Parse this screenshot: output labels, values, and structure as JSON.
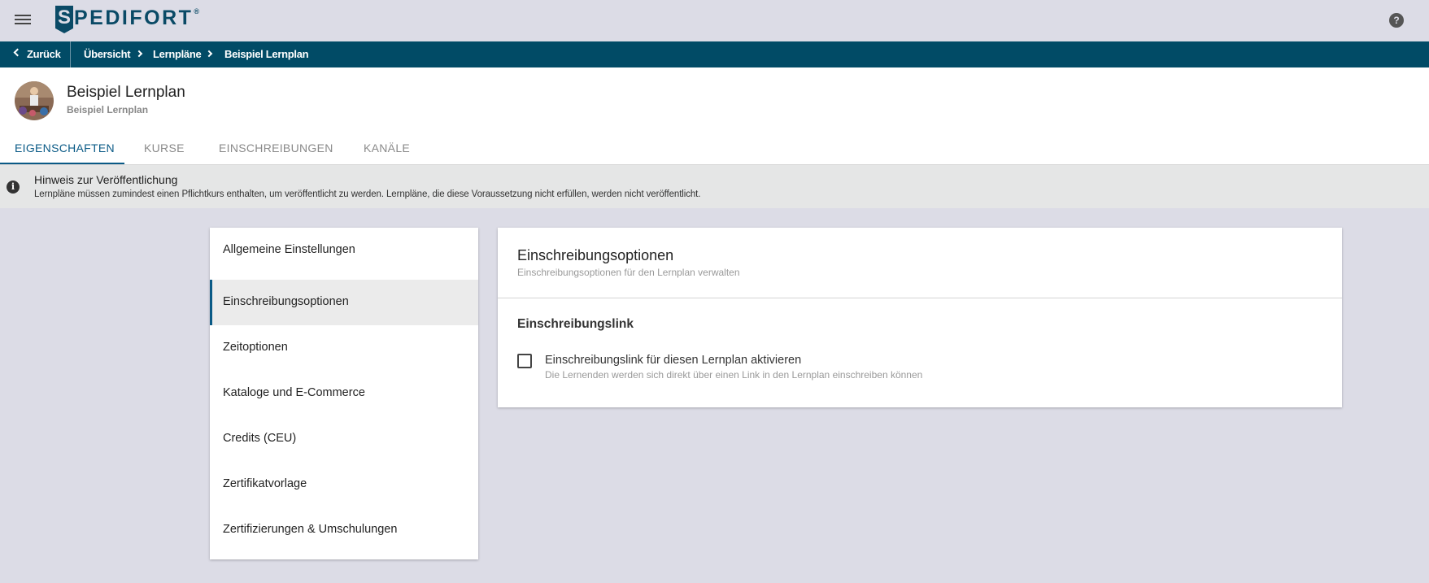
{
  "topbar": {
    "menu_icon": "hamburger-icon",
    "logo": {
      "letter": "S",
      "text": "PEDIFORT",
      "registered": "®"
    },
    "help_icon": "help-icon",
    "help_glyph": "?"
  },
  "navbar": {
    "back_label": "Zurück",
    "breadcrumbs": [
      "Übersicht",
      "Lernpläne",
      "Beispiel Lernplan"
    ]
  },
  "header": {
    "title": "Beispiel Lernplan",
    "subtitle": "Beispiel Lernplan",
    "tabs": [
      {
        "label": "EIGENSCHAFTEN",
        "active": true
      },
      {
        "label": "KURSE",
        "active": false
      },
      {
        "label": "EINSCHREIBUNGEN",
        "active": false
      },
      {
        "label": "KANÄLE",
        "active": false
      }
    ]
  },
  "notice": {
    "icon": "info-icon",
    "title": "Hinweis zur Veröffentlichung",
    "text": "Lernpläne müssen zumindest einen Pflichtkurs enthalten, um veröffentlicht zu werden. Lernpläne, die diese Voraussetzung nicht erfüllen, werden nicht veröffentlicht."
  },
  "sidebar": {
    "items": [
      {
        "label": "Allgemeine Einstellungen",
        "active": false
      },
      {
        "label": "Einschreibungsoptionen",
        "active": true
      },
      {
        "label": "Zeitoptionen",
        "active": false
      },
      {
        "label": "Kataloge und E-Commerce",
        "active": false
      },
      {
        "label": "Credits (CEU)",
        "active": false
      },
      {
        "label": "Zertifikatvorlage",
        "active": false
      },
      {
        "label": "Zertifizierungen & Umschulungen",
        "active": false
      }
    ]
  },
  "panel": {
    "title": "Einschreibungsoptionen",
    "subtitle": "Einschreibungsoptionen für den Lernplan verwalten",
    "section_title": "Einschreibungslink",
    "checkbox_label": "Einschreibungslink für diesen Lernplan aktivieren",
    "checkbox_help": "Die Lernenden werden sich direkt über einen Link in den Lernplan einschreiben können",
    "checkbox_checked": false
  },
  "colors": {
    "navbar": "#014b66",
    "accent": "#0a5a86",
    "background": "#dcdce6"
  }
}
